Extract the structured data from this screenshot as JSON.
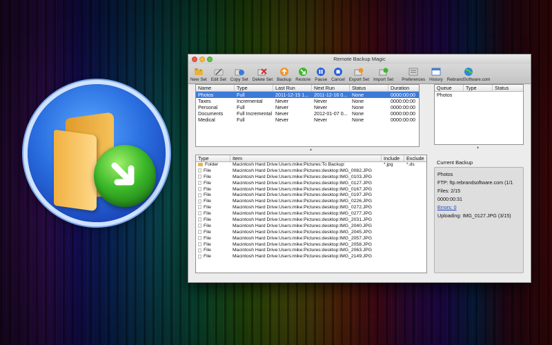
{
  "window": {
    "title": "Remote Backup Magic"
  },
  "toolbar": {
    "items": [
      {
        "label": "New Set",
        "icon": "new-set-icon"
      },
      {
        "label": "Edit Set",
        "icon": "edit-set-icon"
      },
      {
        "label": "Copy Set",
        "icon": "copy-set-icon"
      },
      {
        "label": "Delete Set",
        "icon": "delete-set-icon"
      },
      {
        "label": "Backup",
        "icon": "backup-icon"
      },
      {
        "label": "Restore",
        "icon": "restore-icon"
      },
      {
        "label": "Pause",
        "icon": "pause-icon"
      },
      {
        "label": "Cancel",
        "icon": "cancel-icon"
      },
      {
        "label": "Export Set",
        "icon": "export-set-icon"
      },
      {
        "label": "Import Set",
        "icon": "import-set-icon"
      },
      {
        "label": "Preferences",
        "icon": "preferences-icon"
      },
      {
        "label": "History",
        "icon": "history-icon"
      },
      {
        "label": "RebrandSoftware.com",
        "icon": "globe-icon"
      }
    ]
  },
  "sets": {
    "columns": [
      "Name",
      "Type",
      "Last Run",
      "Next Run",
      "Status",
      "Duration"
    ],
    "rows": [
      [
        "Photos",
        "Full",
        "2011-12-15 1...",
        "2011-12-16 0...",
        "None",
        "0000:00:00"
      ],
      [
        "Taxes",
        "Incremental",
        "Never",
        "Never",
        "None",
        "0000:00:00"
      ],
      [
        "Personal",
        "Full",
        "Never",
        "Never",
        "None",
        "0000:00:00"
      ],
      [
        "Documents",
        "Full Incremental",
        "Never",
        "2012-01-07 0...",
        "None",
        "0000:00:00"
      ],
      [
        "Medical",
        "Full",
        "Never",
        "Never",
        "None",
        "0000:00:00"
      ]
    ]
  },
  "queue": {
    "columns": [
      "Queue",
      "Type",
      "Status"
    ],
    "rows": [
      [
        "Photos",
        "",
        ""
      ]
    ]
  },
  "items": {
    "columns": [
      "Type",
      "Item",
      "Include",
      "Exclude"
    ],
    "rows": [
      [
        "Folder",
        "Macintosh Hard Drive:Users:mike:Pictures:To Backup:",
        "*.jpg",
        "*.ds"
      ],
      [
        "File",
        "Macintosh Hard Drive:Users:mike:Pictures:desktop:IMG_0082.JPG",
        "",
        ""
      ],
      [
        "File",
        "Macintosh Hard Drive:Users:mike:Pictures:desktop:IMG_0103.JPG",
        "",
        ""
      ],
      [
        "File",
        "Macintosh Hard Drive:Users:mike:Pictures:desktop:IMG_0127.JPG",
        "",
        ""
      ],
      [
        "File",
        "Macintosh Hard Drive:Users:mike:Pictures:desktop:IMG_0167.JPG",
        "",
        ""
      ],
      [
        "File",
        "Macintosh Hard Drive:Users:mike:Pictures:desktop:IMG_0197.JPG",
        "",
        ""
      ],
      [
        "File",
        "Macintosh Hard Drive:Users:mike:Pictures:desktop:IMG_0226.JPG",
        "",
        ""
      ],
      [
        "File",
        "Macintosh Hard Drive:Users:mike:Pictures:desktop:IMG_0272.JPG",
        "",
        ""
      ],
      [
        "File",
        "Macintosh Hard Drive:Users:mike:Pictures:desktop:IMG_0277.JPG",
        "",
        ""
      ],
      [
        "File",
        "Macintosh Hard Drive:Users:mike:Pictures:desktop:IMG_2031.JPG",
        "",
        ""
      ],
      [
        "File",
        "Macintosh Hard Drive:Users:mike:Pictures:desktop:IMG_2040.JPG",
        "",
        ""
      ],
      [
        "File",
        "Macintosh Hard Drive:Users:mike:Pictures:desktop:IMG_2045.JPG",
        "",
        ""
      ],
      [
        "File",
        "Macintosh Hard Drive:Users:mike:Pictures:desktop:IMG_2057.JPG",
        "",
        ""
      ],
      [
        "File",
        "Macintosh Hard Drive:Users:mike:Pictures:desktop:IMG_2058.JPG",
        "",
        ""
      ],
      [
        "File",
        "Macintosh Hard Drive:Users:mike:Pictures:desktop:IMG_2063.JPG",
        "",
        ""
      ],
      [
        "File",
        "Macintosh Hard Drive:Users:mike:Pictures:desktop:IMG_2149.JPG",
        "",
        ""
      ]
    ]
  },
  "current_backup": {
    "title": "Current Backup",
    "set_name": "Photos",
    "ftp": "FTP: ftp.rebrandsoftware.com (1/1",
    "files": "Files: 2/15",
    "elapsed": "0000:00:31",
    "errors_link": "Errors: 0",
    "uploading": "Uploading: IMG_0127.JPG (3/15)"
  },
  "colors": {
    "selection": "#3d7ad8",
    "link": "#1b46c6",
    "accent_green": "#3cb82a",
    "accent_blue": "#2a6fe0"
  }
}
